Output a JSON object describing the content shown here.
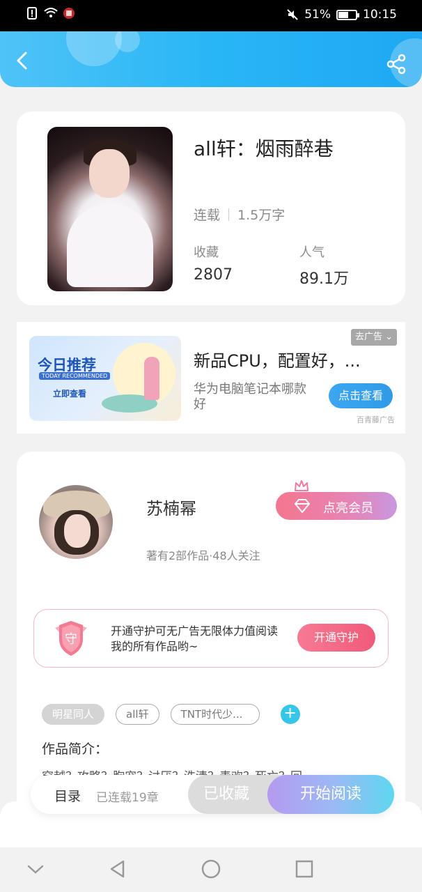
{
  "status_bar": {
    "battery": "51%",
    "time": "10:15"
  },
  "header": {
    "back_icon": "chevron-left-icon",
    "share_icon": "share-icon"
  },
  "book": {
    "title": "all轩：烟雨醉巷",
    "status": "连载",
    "word_count": "1.5万字",
    "favorites_label": "收藏",
    "favorites_value": "2807",
    "popularity_label": "人气",
    "popularity_value": "89.1万"
  },
  "ad": {
    "image_title": "今日推荐",
    "image_subtitle": "TODAY RECOMMENDED",
    "image_cta": "立即查看",
    "title": "新品CPU，配置好，...",
    "description": "华为电脑笔记本哪款好",
    "button": "点击查看",
    "close_label": "去广告 ⌄",
    "source": "百青藤广告"
  },
  "author": {
    "name": "苏楠幂",
    "stats": "著有2部作品·48人关注",
    "vip_button": "点亮会员",
    "guard_text": "开通守护可无广告无限体力值阅读我的所有作品哟~",
    "guard_shield": "守",
    "guard_button": "开通守护"
  },
  "tags": [
    "明星同人",
    "all轩",
    "TNT时代少..."
  ],
  "tag_add": "+",
  "intro": {
    "label": "作品简介：",
    "text": "穿越？攻略？胸宠？讨厌？洗清？毒欢？死亡？回"
  },
  "bottom_bar": {
    "toc": "目录",
    "chapters": "已连载19章",
    "saved": "已收藏",
    "read": "开始阅读"
  },
  "colors": {
    "header": "#29b6f6",
    "accent_pink": "#f05a7a",
    "accent_blue": "#2f9be8"
  }
}
